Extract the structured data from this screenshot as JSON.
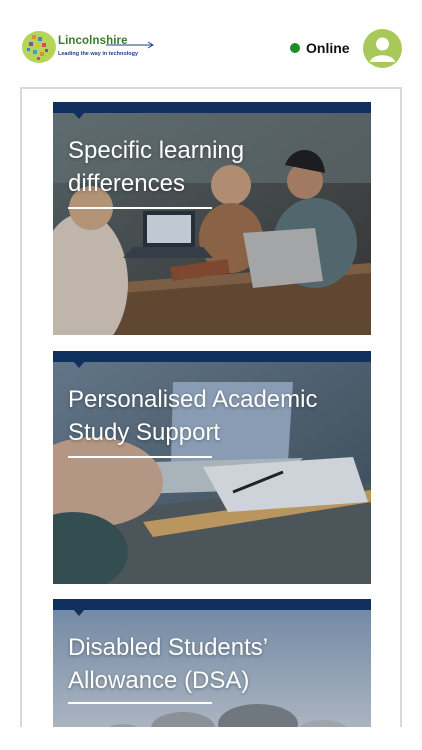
{
  "header": {
    "logo": {
      "brand": "Lincolnshire",
      "tagline": "Leading the way in technology"
    },
    "status": {
      "label": "Online",
      "color": "#1e8c2a"
    },
    "avatar_icon": "user-avatar-icon"
  },
  "cards": [
    {
      "title": "Specific learning differences"
    },
    {
      "title": "Personalised Academic Study Support"
    },
    {
      "title": "Disabled Students’ Allowance (DSA)"
    }
  ],
  "colors": {
    "card_bar": "#10305e",
    "avatar": "#a9c85a",
    "brand_green": "#3a7a2a",
    "brand_blue": "#1d3f8a"
  }
}
